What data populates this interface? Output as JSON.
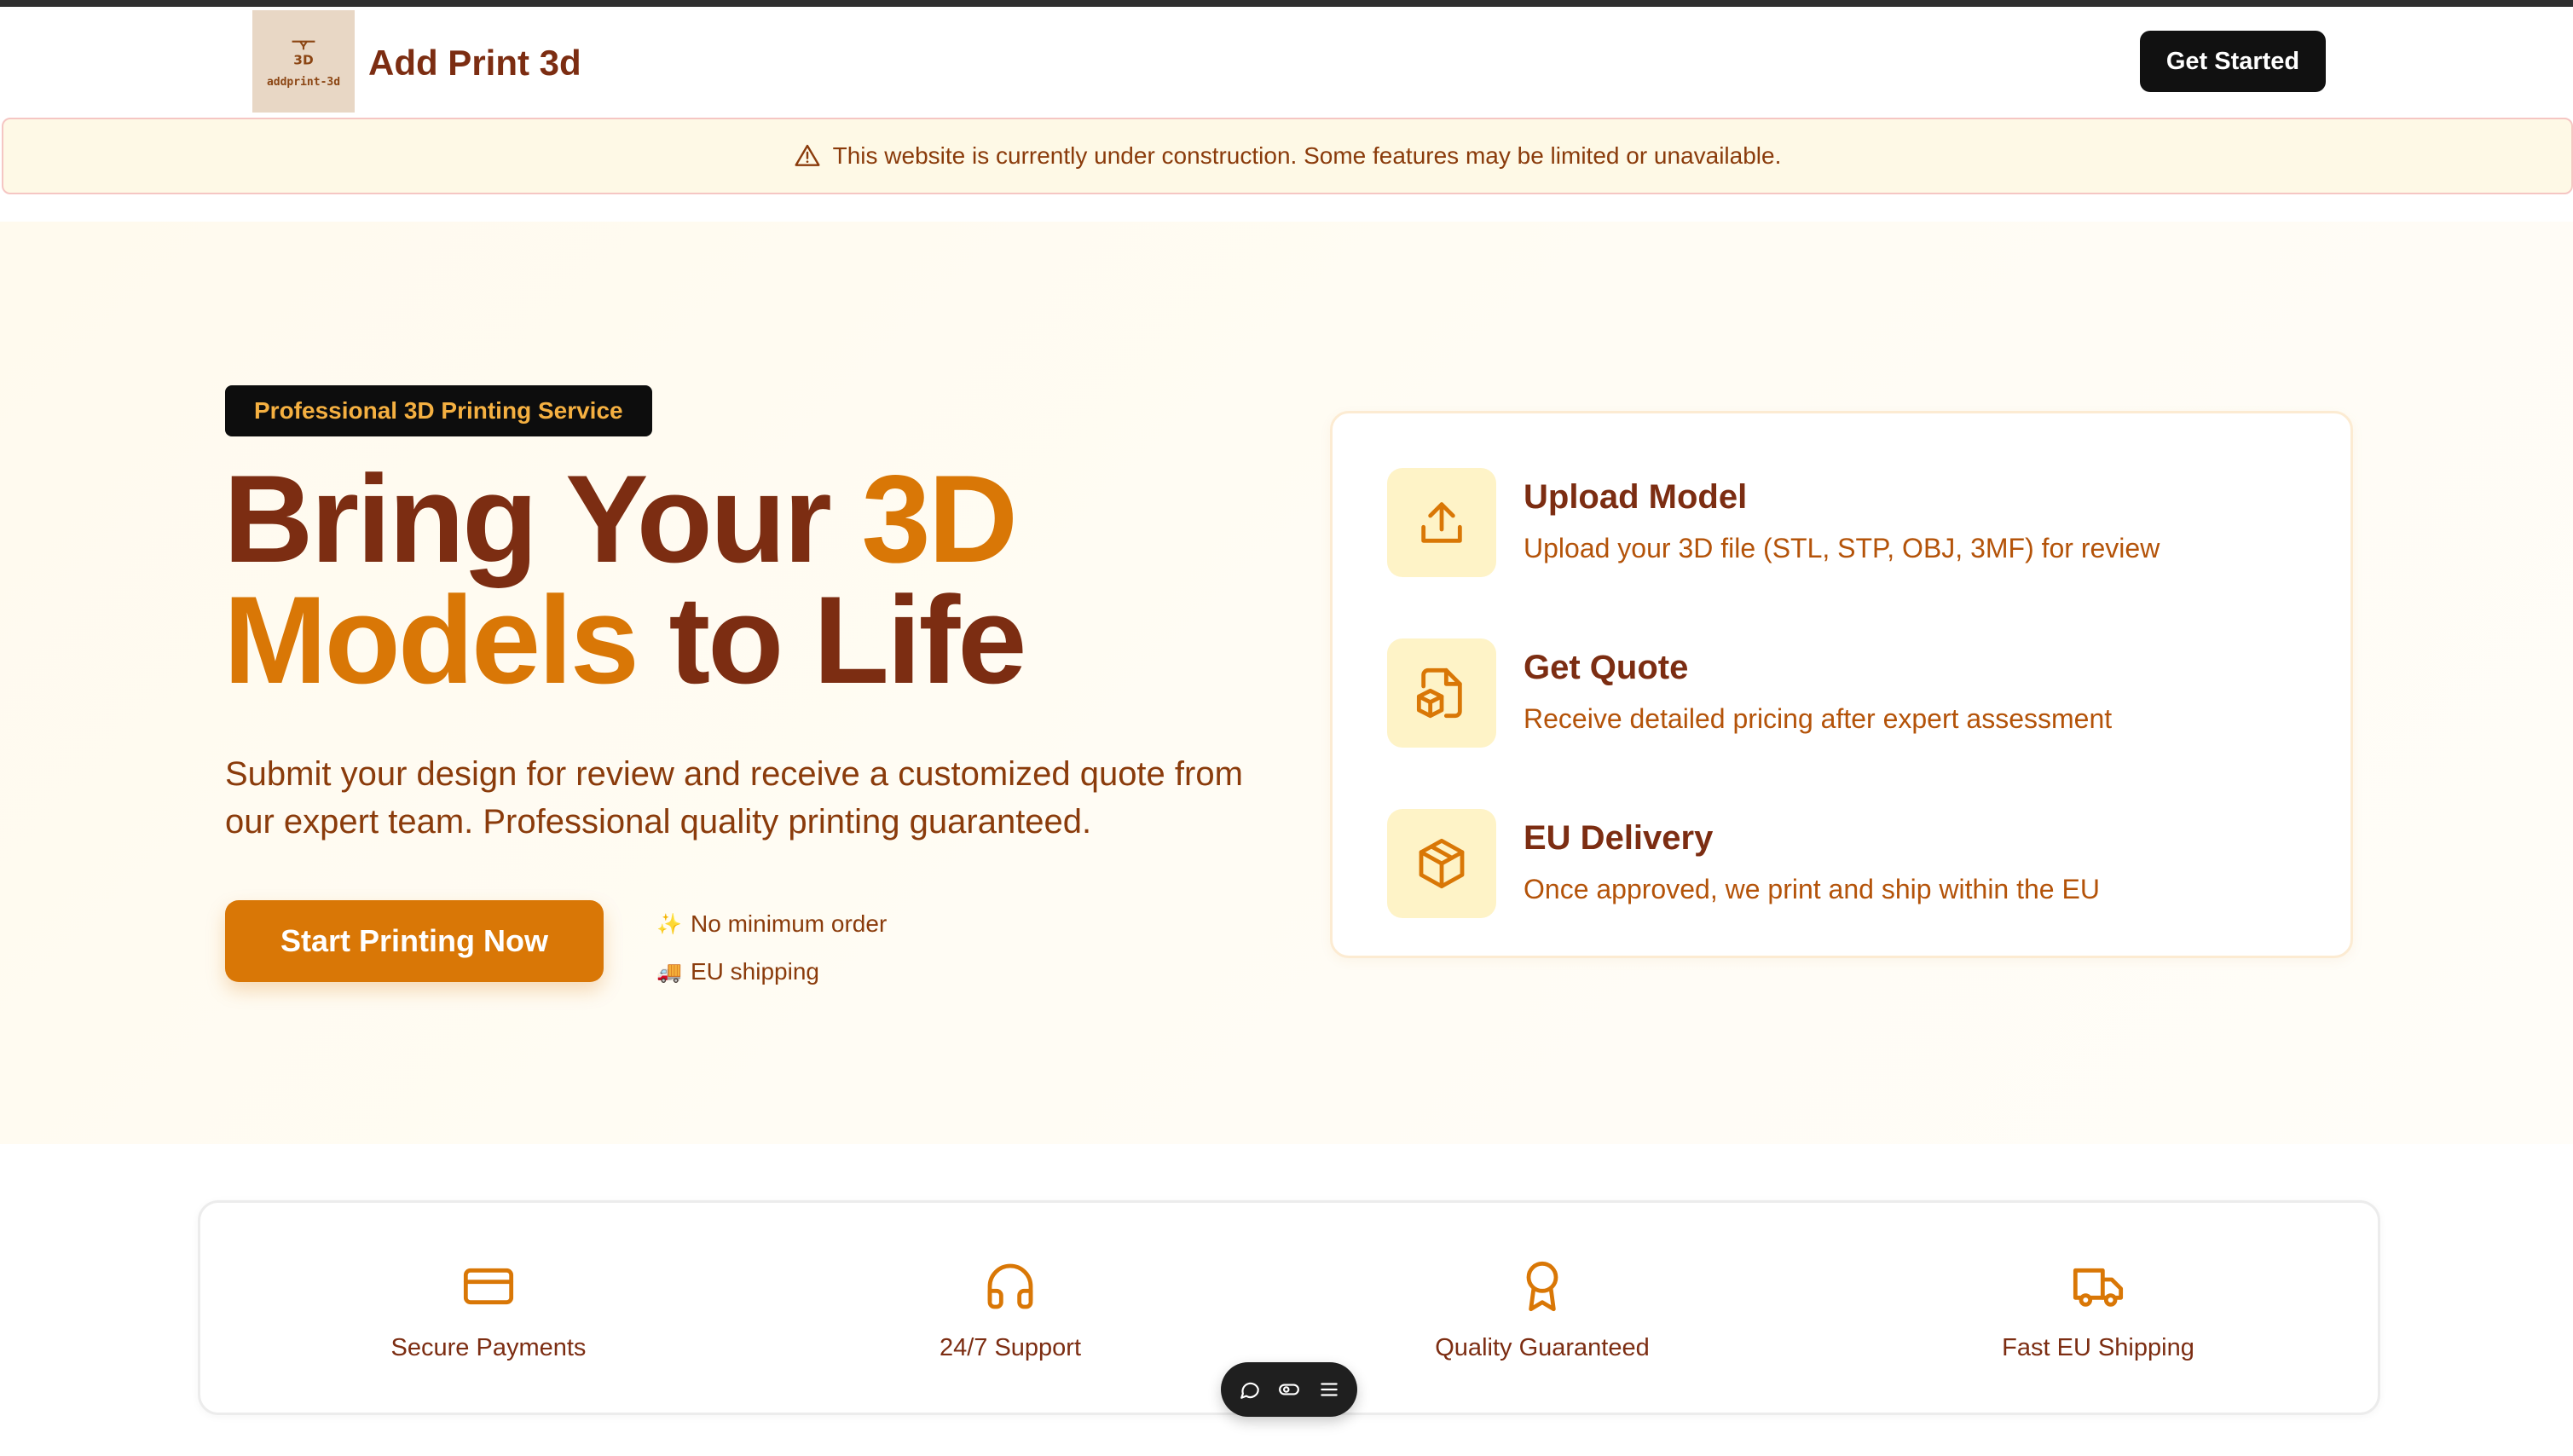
{
  "header": {
    "logo_text": "addprint-3d",
    "brand": "Add Print 3d",
    "cta_label": "Get Started"
  },
  "banner": {
    "message": "This website is currently under construction. Some features may be limited or unavailable."
  },
  "hero": {
    "pill": "Professional 3D Printing Service",
    "headline_part1": "Bring Your ",
    "headline_accent1": "3D",
    "headline_accent2": "Models",
    "headline_part2": " to Life",
    "subheading": "Submit your design for review and receive a customized quote from our expert team. Professional quality printing guaranteed.",
    "cta_label": "Start Printing Now",
    "perks": [
      {
        "icon": "✨",
        "label": "No minimum order"
      },
      {
        "icon": "🚚",
        "label": "EU shipping"
      }
    ]
  },
  "steps": [
    {
      "icon": "upload-icon",
      "title": "Upload Model",
      "desc": "Upload your 3D file (STL, STP, OBJ, 3MF) for review"
    },
    {
      "icon": "file-box-icon",
      "title": "Get Quote",
      "desc": "Receive detailed pricing after expert assessment"
    },
    {
      "icon": "package-icon",
      "title": "EU Delivery",
      "desc": "Once approved, we print and ship within the EU"
    }
  ],
  "features": [
    {
      "icon": "credit-card-icon",
      "label": "Secure Payments"
    },
    {
      "icon": "headphones-icon",
      "label": "24/7 Support"
    },
    {
      "icon": "award-icon",
      "label": "Quality Guaranteed"
    },
    {
      "icon": "truck-icon",
      "label": "Fast EU Shipping"
    }
  ],
  "colors": {
    "brand_dark": "#7c2d12",
    "accent": "#d97706",
    "icon_bg": "#fef3c7",
    "banner_bg": "#fef9e6"
  }
}
